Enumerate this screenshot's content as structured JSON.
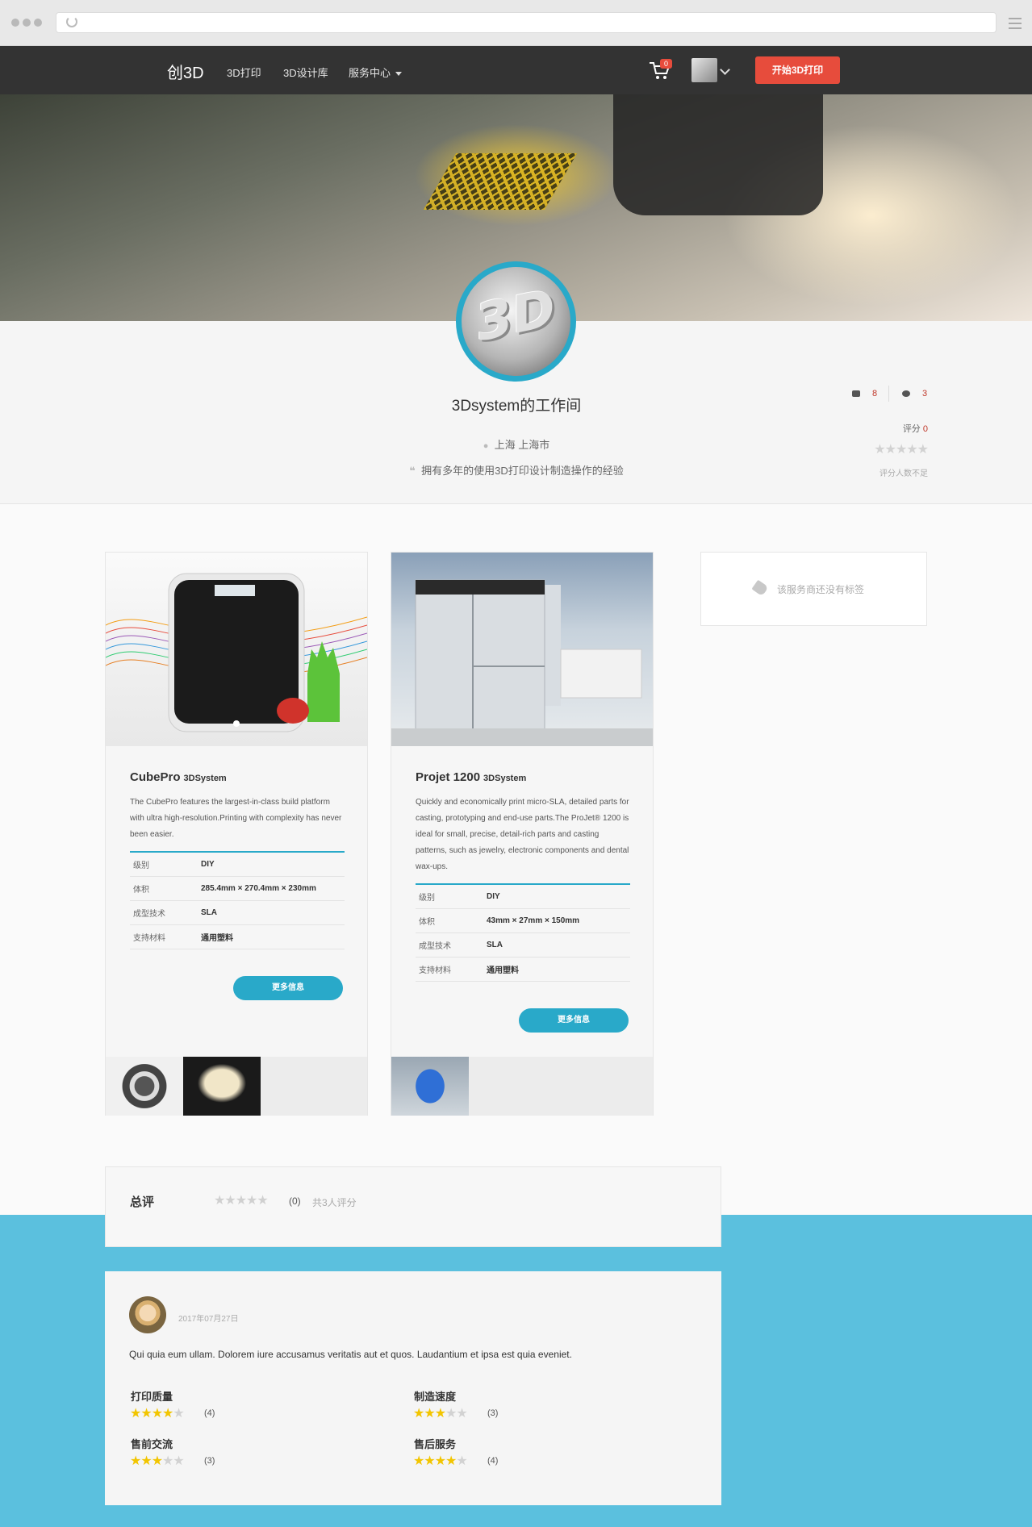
{
  "nav": {
    "logo": "创3D",
    "links": [
      "3D打印",
      "3D设计库",
      "服务中心"
    ],
    "cart_count": "0",
    "cta": "开始3D打印"
  },
  "profile": {
    "name": "3Dsystem的工作间",
    "location": "上海 上海市",
    "quote": "拥有多年的使用3D打印设计制造操作的经验",
    "print_count": "8",
    "comment_count": "3",
    "score_label": "评分",
    "score_value": "0",
    "score_note": "评分人数不足"
  },
  "products": [
    {
      "name": "CubePro",
      "brand": "3DSystem",
      "description": "The CubePro features the largest-in-class build platform with ultra high-resolution.Printing with complexity has never been easier.",
      "specs": [
        {
          "key": "级别",
          "value": "DIY"
        },
        {
          "key": "体积",
          "value": "285.4mm × 270.4mm × 230mm"
        },
        {
          "key": "成型技术",
          "value": "SLA"
        },
        {
          "key": "支持材料",
          "value": "通用塑料"
        }
      ],
      "more": "更多信息"
    },
    {
      "name": "Projet 1200",
      "brand": "3DSystem",
      "description": "Quickly and economically print micro-SLA, detailed parts for casting, prototyping and end-use parts.The ProJet® 1200 is ideal for small, precise, detail-rich parts and casting patterns, such as jewelry, electronic components and dental wax-ups.",
      "specs": [
        {
          "key": "级别",
          "value": "DIY"
        },
        {
          "key": "体积",
          "value": "43mm × 27mm × 150mm"
        },
        {
          "key": "成型技术",
          "value": "SLA"
        },
        {
          "key": "支持材料",
          "value": "通用塑料"
        }
      ],
      "more": "更多信息"
    }
  ],
  "tags_empty": "该服务商还没有标签",
  "summary": {
    "title": "总评",
    "count": "(0)",
    "total": "共3人评分"
  },
  "review": {
    "date": "2017年07月27日",
    "text": "Qui quia eum ullam. Dolorem iure accusamus veritatis aut et quos. Laudantium et ipsa est quia eveniet.",
    "ratings": [
      {
        "label": "打印质量",
        "stars": 4,
        "count": "(4)"
      },
      {
        "label": "制造速度",
        "stars": 3,
        "count": "(3)"
      },
      {
        "label": "售前交流",
        "stars": 3,
        "count": "(3)"
      },
      {
        "label": "售后服务",
        "stars": 4,
        "count": "(4)"
      }
    ]
  },
  "colors": {
    "accent": "#29a9c9",
    "cta": "#e74c3c",
    "nav": "#333333",
    "band": "#5bc0de",
    "star": "#f2c500"
  }
}
